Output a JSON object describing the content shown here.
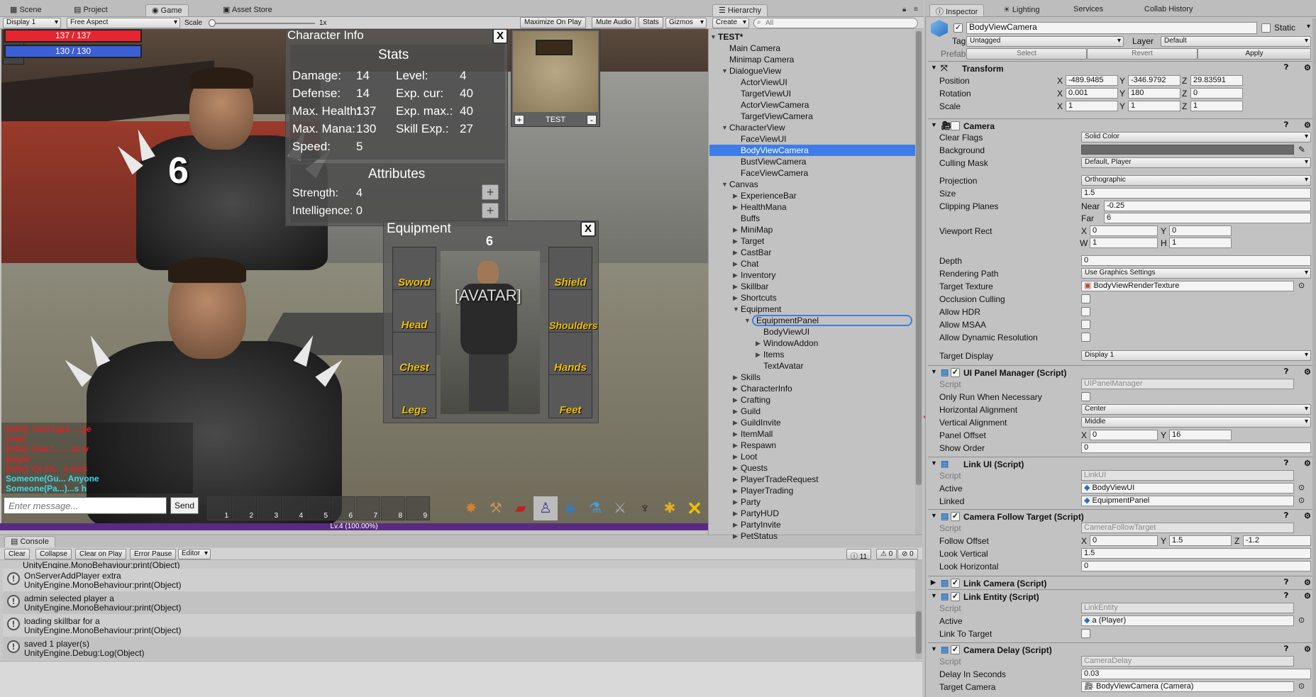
{
  "scene_tabs": {
    "scene": "Scene",
    "project": "Project",
    "game": "Game",
    "asset_store": "Asset Store"
  },
  "game_toolbar": {
    "display": "Display 1",
    "aspect": "Free Aspect",
    "scale_label": "Scale",
    "scale_value": "1x",
    "maximize": "Maximize On Play",
    "mute": "Mute Audio",
    "stats": "Stats",
    "gizmos": "Gizmos"
  },
  "hud": {
    "health": "137 / 137",
    "mana": "130 / 130",
    "level_bar": "Lv.4 (100.00%)"
  },
  "character_info": {
    "title": "Character Info",
    "close": "X",
    "stats_heading": "Stats",
    "stats": [
      {
        "label": "Damage:",
        "value": "14"
      },
      {
        "label": "Defense:",
        "value": "14"
      },
      {
        "label": "Max. Health:",
        "value": "137"
      },
      {
        "label": "Max. Mana:",
        "value": "130"
      },
      {
        "label": "Speed:",
        "value": "5"
      }
    ],
    "stats_right": [
      {
        "label": "Level:",
        "value": "4"
      },
      {
        "label": "Exp. cur:",
        "value": "40"
      },
      {
        "label": "Exp. max.:",
        "value": "40"
      },
      {
        "label": "Skill Exp.:",
        "value": "27"
      }
    ],
    "attributes_heading": "Attributes",
    "attributes": [
      {
        "label": "Strength:",
        "value": "4"
      },
      {
        "label": "Intelligence:",
        "value": "0"
      }
    ],
    "plus": "+"
  },
  "minimap": {
    "label": "TEST",
    "plus": "+",
    "minus": "-"
  },
  "equipment": {
    "title": "Equipment",
    "close": "X",
    "number": "6",
    "avatar": "[AVATAR]",
    "slots_left": [
      "Sword",
      "Head",
      "Chest",
      "Legs"
    ],
    "slots_right": [
      "Shield",
      "Shoulders",
      "Hands",
      "Feet"
    ]
  },
  "overhead_number": "6",
  "chat": {
    "lines": [
      {
        "text": "[Info]: Just type ... ge",
        "color": "#e02020"
      },
      {
        "text": "chat!",
        "color": "#e02020"
      },
      {
        "text": "[Info]: Use /... ... to w",
        "color": "#e02020"
      },
      {
        "text": "player",
        "color": "#e02020"
      },
      {
        "text": "[Info]: Or cli... a mes",
        "color": "#e02020"
      },
      {
        "text": "Someone(Gu... Anyone",
        "color": "#40d8e8"
      },
      {
        "text": "Someone(Pa...)...s h",
        "color": "#40d8e8"
      }
    ],
    "placeholder": "Enter message...",
    "send": "Send"
  },
  "hotbar": {
    "slots": [
      "1",
      "2",
      "3",
      "4",
      "5",
      "6",
      "7",
      "8",
      "9"
    ]
  },
  "hierarchy": {
    "tab": "Hierarchy",
    "create": "Create",
    "search_placeholder": "All",
    "items": [
      {
        "label": "TEST*",
        "depth": 0,
        "arrow": "▼",
        "bold": true
      },
      {
        "label": "Main Camera",
        "depth": 1,
        "arrow": ""
      },
      {
        "label": "Minimap Camera",
        "depth": 1,
        "arrow": ""
      },
      {
        "label": "DialogueView",
        "depth": 1,
        "arrow": "▼"
      },
      {
        "label": "ActorViewUI",
        "depth": 2,
        "arrow": ""
      },
      {
        "label": "TargetViewUI",
        "depth": 2,
        "arrow": ""
      },
      {
        "label": "ActorViewCamera",
        "depth": 2,
        "arrow": ""
      },
      {
        "label": "TargetViewCamera",
        "depth": 2,
        "arrow": ""
      },
      {
        "label": "CharacterView",
        "depth": 1,
        "arrow": "▼"
      },
      {
        "label": "FaceViewUI",
        "depth": 2,
        "arrow": ""
      },
      {
        "label": "BodyViewCamera",
        "depth": 2,
        "arrow": "",
        "selected": true
      },
      {
        "label": "BustViewCamera",
        "depth": 2,
        "arrow": ""
      },
      {
        "label": "FaceViewCamera",
        "depth": 2,
        "arrow": ""
      },
      {
        "label": "Canvas",
        "depth": 1,
        "arrow": "▼"
      },
      {
        "label": "ExperienceBar",
        "depth": 2,
        "arrow": "▶"
      },
      {
        "label": "HealthMana",
        "depth": 2,
        "arrow": "▶"
      },
      {
        "label": "Buffs",
        "depth": 2,
        "arrow": ""
      },
      {
        "label": "MiniMap",
        "depth": 2,
        "arrow": "▶"
      },
      {
        "label": "Target",
        "depth": 2,
        "arrow": "▶"
      },
      {
        "label": "CastBar",
        "depth": 2,
        "arrow": "▶"
      },
      {
        "label": "Chat",
        "depth": 2,
        "arrow": "▶"
      },
      {
        "label": "Inventory",
        "depth": 2,
        "arrow": "▶"
      },
      {
        "label": "Skillbar",
        "depth": 2,
        "arrow": "▶"
      },
      {
        "label": "Shortcuts",
        "depth": 2,
        "arrow": "▶"
      },
      {
        "label": "Equipment",
        "depth": 2,
        "arrow": "▼"
      },
      {
        "label": "EquipmentPanel",
        "depth": 3,
        "arrow": "▼",
        "outlined": true
      },
      {
        "label": "BodyViewUI",
        "depth": 4,
        "arrow": ""
      },
      {
        "label": "WindowAddon",
        "depth": 4,
        "arrow": "▶"
      },
      {
        "label": "Items",
        "depth": 4,
        "arrow": "▶"
      },
      {
        "label": "TextAvatar",
        "depth": 4,
        "arrow": ""
      },
      {
        "label": "Skills",
        "depth": 2,
        "arrow": "▶"
      },
      {
        "label": "CharacterInfo",
        "depth": 2,
        "arrow": "▶"
      },
      {
        "label": "Crafting",
        "depth": 2,
        "arrow": "▶"
      },
      {
        "label": "Guild",
        "depth": 2,
        "arrow": "▶"
      },
      {
        "label": "GuildInvite",
        "depth": 2,
        "arrow": "▶"
      },
      {
        "label": "ItemMall",
        "depth": 2,
        "arrow": "▶"
      },
      {
        "label": "Respawn",
        "depth": 2,
        "arrow": "▶"
      },
      {
        "label": "Loot",
        "depth": 2,
        "arrow": "▶"
      },
      {
        "label": "Quests",
        "depth": 2,
        "arrow": "▶"
      },
      {
        "label": "PlayerTradeRequest",
        "depth": 2,
        "arrow": "▶"
      },
      {
        "label": "PlayerTrading",
        "depth": 2,
        "arrow": "▶"
      },
      {
        "label": "Party",
        "depth": 2,
        "arrow": "▶"
      },
      {
        "label": "PartyHUD",
        "depth": 2,
        "arrow": "▶"
      },
      {
        "label": "PartyInvite",
        "depth": 2,
        "arrow": "▶"
      },
      {
        "label": "PetStatus",
        "depth": 2,
        "arrow": "▶"
      }
    ]
  },
  "inspector_tabs": {
    "inspector": "Inspector",
    "lighting": "Lighting",
    "services": "Services",
    "collab": "Collab History"
  },
  "inspector": {
    "object_name": "BodyViewCamera",
    "static": "Static",
    "tag_label": "Tag",
    "tag_value": "Untagged",
    "layer_label": "Layer",
    "layer_value": "Default",
    "prefab_label": "Prefab",
    "select": "Select",
    "revert": "Revert",
    "apply": "Apply",
    "transform": {
      "title": "Transform",
      "position_label": "Position",
      "position": [
        "-489.9485",
        "-346.9792",
        "29.83591"
      ],
      "rotation_label": "Rotation",
      "rotation": [
        "0.001",
        "180",
        "0"
      ],
      "scale_label": "Scale",
      "scale": [
        "1",
        "1",
        "1"
      ]
    },
    "camera": {
      "title": "Camera",
      "clear_flags_label": "Clear Flags",
      "clear_flags": "Solid Color",
      "background_label": "Background",
      "culling_mask_label": "Culling Mask",
      "culling_mask": "Default, Player",
      "projection_label": "Projection",
      "projection": "Orthographic",
      "size_label": "Size",
      "size": "1.5",
      "clipping_label": "Clipping Planes",
      "near_label": "Near",
      "near": "-0.25",
      "far_label": "Far",
      "far": "6",
      "viewport_label": "Viewport Rect",
      "vx": "0",
      "vy": "0",
      "vw": "1",
      "vh": "1",
      "depth_label": "Depth",
      "depth": "0",
      "rendering_path_label": "Rendering Path",
      "rendering_path": "Use Graphics Settings",
      "target_texture_label": "Target Texture",
      "target_texture": "BodyViewRenderTexture",
      "occlusion_label": "Occlusion Culling",
      "hdr_label": "Allow HDR",
      "msaa_label": "Allow MSAA",
      "dynres_label": "Allow Dynamic Resolution",
      "target_display_label": "Target Display",
      "target_display": "Display 1"
    },
    "ui_panel_manager": {
      "title": "UI Panel Manager (Script)",
      "script_label": "Script",
      "script": "UIPanelManager",
      "only_run_label": "Only Run When Necessary",
      "h_align_label": "Horizontal Alignment",
      "h_align": "Center",
      "v_align_label": "Vertical Alignment",
      "v_align": "Middle",
      "offset_label": "Panel Offset",
      "offset_x": "0",
      "offset_y": "16",
      "show_order_label": "Show Order",
      "show_order": "0"
    },
    "link_ui": {
      "title": "Link UI (Script)",
      "script_label": "Script",
      "script": "LinkUI",
      "active_label": "Active",
      "active": "BodyViewUI",
      "linked_label": "Linked",
      "linked": "EquipmentPanel"
    },
    "camera_follow": {
      "title": "Camera Follow Target (Script)",
      "script_label": "Script",
      "script": "CameraFollowTarget",
      "follow_offset_label": "Follow Offset",
      "fx": "0",
      "fy": "1.5",
      "fz": "-1.2",
      "look_vertical_label": "Look Vertical",
      "look_vertical": "1.5",
      "look_horizontal_label": "Look Horizontal",
      "look_horizontal": "0"
    },
    "link_camera": {
      "title": "Link Camera (Script)"
    },
    "link_entity": {
      "title": "Link Entity (Script)",
      "script_label": "Script",
      "script": "LinkEntity",
      "active_label": "Active",
      "active": "a (Player)",
      "link_target_label": "Link To Target"
    },
    "camera_delay": {
      "title": "Camera Delay (Script)",
      "script_label": "Script",
      "script": "CameraDelay",
      "delay_label": "Delay In Seconds",
      "delay": "0.03",
      "target_camera_label": "Target Camera",
      "target_camera": "BodyViewCamera (Camera)"
    }
  },
  "console": {
    "tab": "Console",
    "buttons": [
      "Clear",
      "Collapse",
      "Clear on Play",
      "Error Pause",
      "Editor"
    ],
    "count_info": "11",
    "count_warn": "0",
    "count_err": "0",
    "top_partial": "UnityEngine.MonoBehaviour:print(Object)",
    "logs": [
      {
        "line1": "OnServerAddPlayer extra",
        "line2": "UnityEngine.MonoBehaviour:print(Object)"
      },
      {
        "line1": "admin selected player a",
        "line2": "UnityEngine.MonoBehaviour:print(Object)"
      },
      {
        "line1": "loading skillbar for a",
        "line2": "UnityEngine.MonoBehaviour:print(Object)"
      },
      {
        "line1": "saved 1 player(s)",
        "line2": "UnityEngine.Debug:Log(Object)"
      }
    ]
  },
  "colors": {
    "health": "#e52631",
    "mana": "#3a5fd6",
    "selection": "#3e7de7",
    "exp_bar": "#5a2a82",
    "annotation": "#b0304a"
  }
}
